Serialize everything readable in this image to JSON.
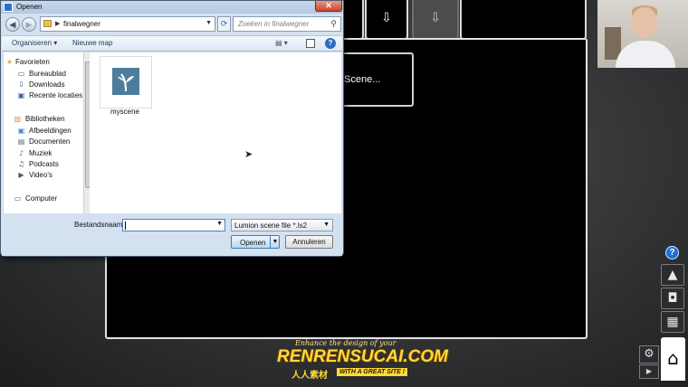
{
  "dialog": {
    "title": "Openen",
    "close_symbol": "✕",
    "address": "finalwegner",
    "search_placeholder": "Zoeken in finalwegner",
    "toolbar": {
      "organize": "Organiseren",
      "new_folder": "Nieuwe map"
    },
    "nav": {
      "favorites": "Favorieten",
      "desktop": "Bureaublad",
      "downloads": "Downloads",
      "recent": "Recente locaties",
      "libraries": "Bibliotheken",
      "pictures": "Afbeeldingen",
      "documents": "Documenten",
      "music": "Muziek",
      "podcasts": "Podcasts",
      "videos": "Video's",
      "computer": "Computer"
    },
    "files": [
      {
        "name": "myscene"
      }
    ],
    "filename_label": "Bestandsnaam:",
    "filename_value": "",
    "filetype": "Lumion scene file *.ls2",
    "open_label": "Openen",
    "cancel_label": "Annuleren"
  },
  "lumion": {
    "scene_label": "Scene...",
    "help_symbol": "?"
  },
  "watermark": {
    "tagline": "Enhance the design of your",
    "brand": "RENRENSUCAI.COM",
    "chinese": "人人素材",
    "slogan": "WITH A GREAT SITE !"
  },
  "icons": {
    "save-tile-1": "save-icon",
    "save-tile-2": "save-icon",
    "mountain": "landscape-icon",
    "camera": "camera-icon",
    "film": "film-icon",
    "home": "home-icon",
    "gear": "gear-icon",
    "play": "play-icon"
  }
}
